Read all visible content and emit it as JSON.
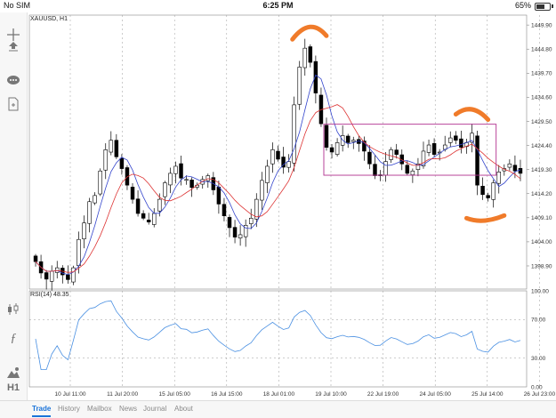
{
  "status_bar": {
    "carrier": "No SIM",
    "time": "6:25 PM",
    "battery": "65%",
    "battery_level": 0.65
  },
  "toolbar": {
    "items": [
      {
        "name": "crosshair-icon"
      },
      {
        "name": "chart-type-icon"
      },
      {
        "name": "indicators-icon"
      },
      {
        "name": "timeframe-label",
        "label": "H1"
      },
      {
        "name": "new-order-icon"
      }
    ]
  },
  "chart": {
    "symbol_label": "XAUUSD, H1",
    "rsi_label": "RSI(14) 48.35",
    "price_axis": [
      "1449.90",
      "1444.80",
      "1439.70",
      "1434.60",
      "1429.50",
      "1424.40",
      "1419.30",
      "1414.20",
      "1409.10",
      "1404.00",
      "1398.90"
    ],
    "rsi_axis": [
      "100.00",
      "70.00",
      "30.00",
      "0.00"
    ],
    "date_axis": [
      "10 Jul 11:00",
      "11 Jul 20:00",
      "15 Jul 05:00",
      "16 Jul 15:00",
      "18 Jul 01:00",
      "19 Jul 10:00",
      "22 Jul 19:00",
      "24 Jul 05:00",
      "25 Jul 14:00",
      "26 Jul 23:00"
    ],
    "colors": {
      "bull": "#ffffff",
      "bear": "#000000",
      "ma_fast": "#3344cc",
      "ma_slow": "#dd3333",
      "rsi": "#4a90e2",
      "range_box": "#b0308f",
      "annotation": "#f07b2a"
    }
  },
  "chart_data": {
    "type": "candlestick",
    "symbol": "XAUUSD",
    "timeframe": "H1",
    "close": [
      1399.8,
      1397.4,
      1396.1,
      1397.8,
      1398.5,
      1397.0,
      1396.0,
      1398.5,
      1404.5,
      1408.0,
      1412.5,
      1413.8,
      1419.0,
      1423.5,
      1425.5,
      1422.0,
      1419.5,
      1416.0,
      1413.0,
      1410.0,
      1409.0,
      1408.2,
      1410.0,
      1413.0,
      1416.5,
      1418.5,
      1420.0,
      1417.5,
      1417.2,
      1415.5,
      1416.0,
      1417.2,
      1418.0,
      1415.0,
      1412.0,
      1409.5,
      1407.0,
      1405.0,
      1405.5,
      1407.5,
      1409.0,
      1413.0,
      1417.0,
      1420.0,
      1423.5,
      1421.5,
      1419.8,
      1421.0,
      1433.0,
      1441.0,
      1445.0,
      1442.0,
      1435.5,
      1429.0,
      1424.0,
      1423.0,
      1425.0,
      1426.5,
      1425.0,
      1425.5,
      1424.8,
      1423.2,
      1420.5,
      1418.0,
      1418.2,
      1421.0,
      1423.5,
      1422.5,
      1420.5,
      1418.5,
      1419.0,
      1420.5,
      1423.2,
      1424.5,
      1422.5,
      1423.0,
      1424.5,
      1426.0,
      1425.5,
      1424.0,
      1425.0,
      1427.0,
      1416.0,
      1414.0,
      1413.3,
      1416.5,
      1418.8,
      1419.5,
      1420.5,
      1419.0,
      1418.5
    ],
    "series": [
      {
        "name": "MA fast",
        "role": "moving average"
      },
      {
        "name": "MA slow",
        "role": "moving average"
      }
    ],
    "rsi": {
      "period": 14,
      "last": 48.35,
      "levels": [
        30,
        70
      ],
      "range": [
        0,
        100
      ]
    },
    "ylim": [
      1394.0,
      1452.0
    ],
    "annotations": [
      {
        "type": "range_box",
        "price_top": 1428.9,
        "price_bottom": 1418.1
      },
      {
        "type": "hand-drawn arc",
        "near": "peak ~1449"
      },
      {
        "type": "hand-drawn arc",
        "near": "peak ~1431"
      },
      {
        "type": "hand-drawn arc",
        "near": "trough ~1411"
      }
    ]
  },
  "tabs": [
    {
      "label": "Trade",
      "active": true
    },
    {
      "label": "History",
      "active": false
    },
    {
      "label": "Mailbox",
      "active": false
    },
    {
      "label": "News",
      "active": false
    },
    {
      "label": "Journal",
      "active": false
    },
    {
      "label": "About",
      "active": false
    }
  ]
}
